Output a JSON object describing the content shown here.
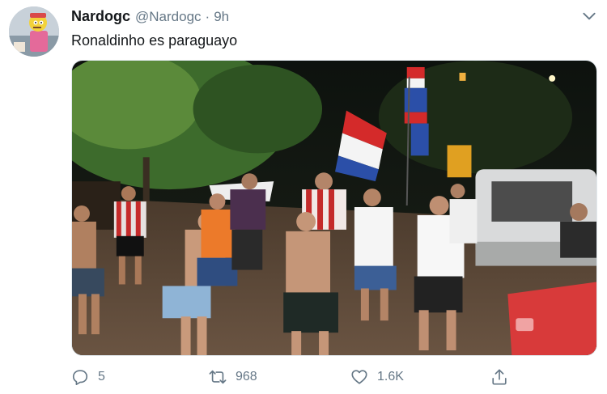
{
  "tweet": {
    "author": {
      "display_name": "Nardogc",
      "handle": "@Nardogc",
      "avatar": "cartoon-character-avatar"
    },
    "separator": "·",
    "timestamp": "9h",
    "text": "Ronaldinho es paraguayo",
    "media": {
      "kind": "photo",
      "description_icon": "street-celebration-photo"
    },
    "actions": {
      "reply": {
        "icon": "reply-icon",
        "count": "5"
      },
      "retweet": {
        "icon": "retweet-icon",
        "count": "968"
      },
      "like": {
        "icon": "heart-icon",
        "count": "1.6K"
      },
      "share": {
        "icon": "share-icon"
      }
    },
    "menu_icon": "chevron-down-icon"
  },
  "colors": {
    "name": "#14171a",
    "secondary": "#657786",
    "border": "#e1e8ed",
    "background": "#ffffff"
  }
}
